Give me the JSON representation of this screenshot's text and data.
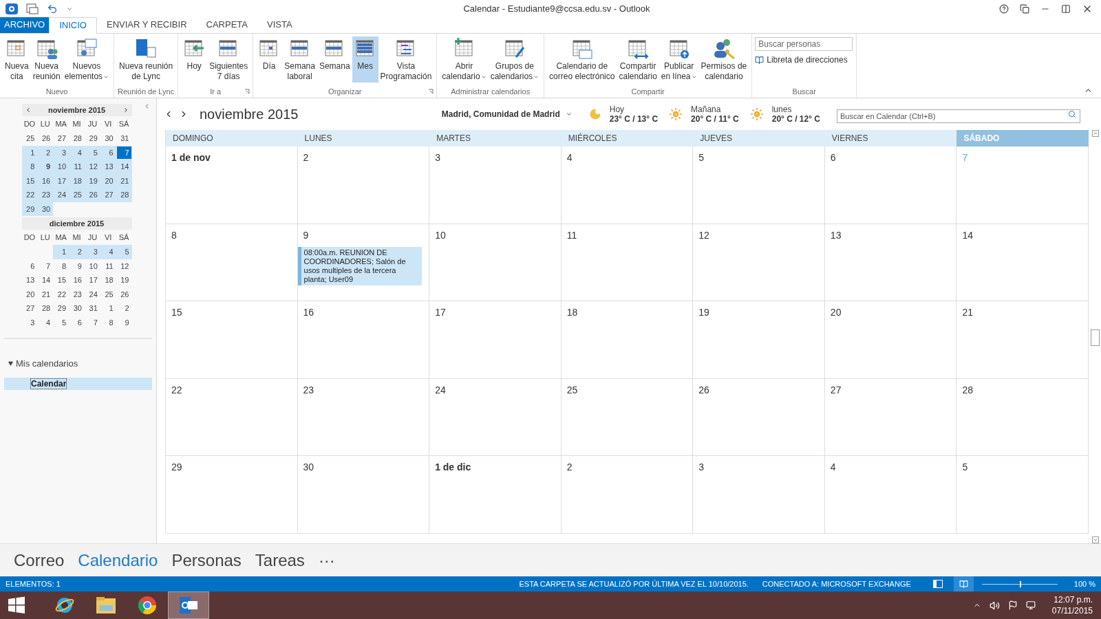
{
  "window": {
    "title": "Calendar - Estudiante9@ccsa.edu.sv - Outlook"
  },
  "ribbon_tabs": [
    {
      "label": "ARCHIVO",
      "kind": "file",
      "selected": false
    },
    {
      "label": "INICIO",
      "kind": "tab",
      "selected": true
    },
    {
      "label": "ENVIAR Y RECIBIR",
      "kind": "tab",
      "selected": false
    },
    {
      "label": "CARPETA",
      "kind": "tab",
      "selected": false
    },
    {
      "label": "VISTA",
      "kind": "tab",
      "selected": false
    }
  ],
  "ribbon_groups": [
    {
      "label": "Nuevo",
      "launcher": false,
      "buttons": [
        {
          "lines": [
            "Nueva",
            "cita"
          ],
          "kind": "plain",
          "dropdown": false,
          "selected": false
        },
        {
          "lines": [
            "Nueva",
            "reunión"
          ],
          "kind": "people",
          "dropdown": false,
          "selected": false
        },
        {
          "lines": [
            "Nuevos",
            "elementos"
          ],
          "kind": "mail",
          "dropdown": true,
          "selected": false
        }
      ]
    },
    {
      "label": "Reunión de Lync",
      "launcher": false,
      "buttons": [
        {
          "lines": [
            "Nueva reunión",
            "de Lync"
          ],
          "kind": "lync",
          "dropdown": false,
          "selected": false
        }
      ]
    },
    {
      "label": "Ir a",
      "launcher": true,
      "buttons": [
        {
          "lines": [
            "Hoy"
          ],
          "kind": "arrow",
          "dropdown": false,
          "selected": false
        },
        {
          "lines": [
            "Siguientes",
            "7 días"
          ],
          "kind": "row",
          "dropdown": false,
          "selected": false
        }
      ]
    },
    {
      "label": "Organizar",
      "launcher": true,
      "buttons": [
        {
          "lines": [
            "Día"
          ],
          "kind": "day",
          "dropdown": false,
          "selected": false
        },
        {
          "lines": [
            "Semana",
            "laboral"
          ],
          "kind": "row",
          "dropdown": false,
          "selected": false
        },
        {
          "lines": [
            "Semana"
          ],
          "kind": "row",
          "dropdown": false,
          "selected": false
        },
        {
          "lines": [
            "Mes"
          ],
          "kind": "month",
          "dropdown": false,
          "selected": true
        },
        {
          "lines": [
            "Vista",
            "Programación"
          ],
          "kind": "schedule",
          "dropdown": false,
          "selected": false
        }
      ]
    },
    {
      "label": "Administrar calendarios",
      "launcher": false,
      "buttons": [
        {
          "lines": [
            "Abrir",
            "calendario"
          ],
          "kind": "plus",
          "dropdown": true,
          "selected": false
        },
        {
          "lines": [
            "Grupos de",
            "calendarios"
          ],
          "kind": "pencil",
          "dropdown": true,
          "selected": false
        }
      ]
    },
    {
      "label": "Compartir",
      "launcher": false,
      "buttons": [
        {
          "lines": [
            "Calendario de",
            "correo electrónico"
          ],
          "kind": "envelope",
          "dropdown": false,
          "selected": false
        },
        {
          "lines": [
            "Compartir",
            "calendario"
          ],
          "kind": "share",
          "dropdown": false,
          "selected": false
        },
        {
          "lines": [
            "Publicar",
            "en línea"
          ],
          "kind": "upload",
          "dropdown": true,
          "selected": false
        },
        {
          "lines": [
            "Permisos de",
            "calendario"
          ],
          "kind": "key",
          "dropdown": false,
          "selected": false
        }
      ]
    }
  ],
  "search_group": {
    "label": "Buscar",
    "field": {
      "placeholder": "Buscar personas"
    },
    "link": "Libreta de direcciones"
  },
  "mini_calendars": [
    {
      "title": "noviembre 2015",
      "arrows": true,
      "weekdays": [
        "DO",
        "LU",
        "MA",
        "MI",
        "JU",
        "VI",
        "SÁ"
      ],
      "weeks": [
        [
          {
            "text": "25",
            "highlighted": false,
            "selected": false,
            "bold": false
          },
          {
            "text": "26",
            "highlighted": false,
            "selected": false,
            "bold": false
          },
          {
            "text": "27",
            "highlighted": false,
            "selected": false,
            "bold": false
          },
          {
            "text": "28",
            "highlighted": false,
            "selected": false,
            "bold": false
          },
          {
            "text": "29",
            "highlighted": false,
            "selected": false,
            "bold": false
          },
          {
            "text": "30",
            "highlighted": false,
            "selected": false,
            "bold": false
          },
          {
            "text": "31",
            "highlighted": false,
            "selected": false,
            "bold": false
          }
        ],
        [
          {
            "text": "1",
            "highlighted": true,
            "selected": false,
            "bold": false
          },
          {
            "text": "2",
            "highlighted": true,
            "selected": false,
            "bold": false
          },
          {
            "text": "3",
            "highlighted": true,
            "selected": false,
            "bold": false
          },
          {
            "text": "4",
            "highlighted": true,
            "selected": false,
            "bold": false
          },
          {
            "text": "5",
            "highlighted": true,
            "selected": false,
            "bold": false
          },
          {
            "text": "6",
            "highlighted": true,
            "selected": false,
            "bold": false
          },
          {
            "text": "7",
            "highlighted": true,
            "selected": true,
            "bold": false
          }
        ],
        [
          {
            "text": "8",
            "highlighted": true,
            "selected": false,
            "bold": false
          },
          {
            "text": "9",
            "highlighted": true,
            "selected": false,
            "bold": true
          },
          {
            "text": "10",
            "highlighted": true,
            "selected": false,
            "bold": false
          },
          {
            "text": "11",
            "highlighted": true,
            "selected": false,
            "bold": false
          },
          {
            "text": "12",
            "highlighted": true,
            "selected": false,
            "bold": false
          },
          {
            "text": "13",
            "highlighted": true,
            "selected": false,
            "bold": false
          },
          {
            "text": "14",
            "highlighted": true,
            "selected": false,
            "bold": false
          }
        ],
        [
          {
            "text": "15",
            "highlighted": true,
            "selected": false,
            "bold": false
          },
          {
            "text": "16",
            "highlighted": true,
            "selected": false,
            "bold": false
          },
          {
            "text": "17",
            "highlighted": true,
            "selected": false,
            "bold": false
          },
          {
            "text": "18",
            "highlighted": true,
            "selected": false,
            "bold": false
          },
          {
            "text": "19",
            "highlighted": true,
            "selected": false,
            "bold": false
          },
          {
            "text": "20",
            "highlighted": true,
            "selected": false,
            "bold": false
          },
          {
            "text": "21",
            "highlighted": true,
            "selected": false,
            "bold": false
          }
        ],
        [
          {
            "text": "22",
            "highlighted": true,
            "selected": false,
            "bold": false
          },
          {
            "text": "23",
            "highlighted": true,
            "selected": false,
            "bold": false
          },
          {
            "text": "24",
            "highlighted": true,
            "selected": false,
            "bold": false
          },
          {
            "text": "25",
            "highlighted": true,
            "selected": false,
            "bold": false
          },
          {
            "text": "26",
            "highlighted": true,
            "selected": false,
            "bold": false
          },
          {
            "text": "27",
            "highlighted": true,
            "selected": false,
            "bold": false
          },
          {
            "text": "28",
            "highlighted": true,
            "selected": false,
            "bold": false
          }
        ],
        [
          {
            "text": "29",
            "highlighted": true,
            "selected": false,
            "bold": false
          },
          {
            "text": "30",
            "highlighted": true,
            "selected": false,
            "bold": false
          }
        ]
      ]
    },
    {
      "title": "diciembre 2015",
      "arrows": false,
      "partial_first_week": true,
      "weekdays": [
        "DO",
        "LU",
        "MA",
        "MI",
        "JU",
        "VI",
        "SÁ"
      ],
      "weeks": [
        [
          {
            "text": "1",
            "highlighted": true,
            "selected": false,
            "bold": false
          },
          {
            "text": "2",
            "highlighted": true,
            "selected": false,
            "bold": false
          },
          {
            "text": "3",
            "highlighted": true,
            "selected": false,
            "bold": false
          },
          {
            "text": "4",
            "highlighted": true,
            "selected": false,
            "bold": false
          },
          {
            "text": "5",
            "highlighted": true,
            "selected": false,
            "bold": false
          }
        ],
        [
          {
            "text": "6",
            "highlighted": false,
            "selected": false,
            "bold": false
          },
          {
            "text": "7",
            "highlighted": false,
            "selected": false,
            "bold": false
          },
          {
            "text": "8",
            "highlighted": false,
            "selected": false,
            "bold": false
          },
          {
            "text": "9",
            "highlighted": false,
            "selected": false,
            "bold": false
          },
          {
            "text": "10",
            "highlighted": false,
            "selected": false,
            "bold": false
          },
          {
            "text": "11",
            "highlighted": false,
            "selected": false,
            "bold": false
          },
          {
            "text": "12",
            "highlighted": false,
            "selected": false,
            "bold": false
          }
        ],
        [
          {
            "text": "13",
            "highlighted": false,
            "selected": false,
            "bold": false
          },
          {
            "text": "14",
            "highlighted": false,
            "selected": false,
            "bold": false
          },
          {
            "text": "15",
            "highlighted": false,
            "selected": false,
            "bold": false
          },
          {
            "text": "16",
            "highlighted": false,
            "selected": false,
            "bold": false
          },
          {
            "text": "17",
            "highlighted": false,
            "selected": false,
            "bold": false
          },
          {
            "text": "18",
            "highlighted": false,
            "selected": false,
            "bold": false
          },
          {
            "text": "19",
            "highlighted": false,
            "selected": false,
            "bold": false
          }
        ],
        [
          {
            "text": "20",
            "highlighted": false,
            "selected": false,
            "bold": false
          },
          {
            "text": "21",
            "highlighted": false,
            "selected": false,
            "bold": false
          },
          {
            "text": "22",
            "highlighted": false,
            "selected": false,
            "bold": false
          },
          {
            "text": "23",
            "highlighted": false,
            "selected": false,
            "bold": false
          },
          {
            "text": "24",
            "highlighted": false,
            "selected": false,
            "bold": false
          },
          {
            "text": "25",
            "highlighted": false,
            "selected": false,
            "bold": false
          },
          {
            "text": "26",
            "highlighted": false,
            "selected": false,
            "bold": false
          }
        ],
        [
          {
            "text": "27",
            "highlighted": false,
            "selected": false,
            "bold": false
          },
          {
            "text": "28",
            "highlighted": false,
            "selected": false,
            "bold": false
          },
          {
            "text": "29",
            "highlighted": false,
            "selected": false,
            "bold": false
          },
          {
            "text": "30",
            "highlighted": false,
            "selected": false,
            "bold": false
          },
          {
            "text": "31",
            "highlighted": false,
            "selected": false,
            "bold": false
          },
          {
            "text": "1",
            "highlighted": false,
            "selected": false,
            "bold": false
          },
          {
            "text": "2",
            "highlighted": false,
            "selected": false,
            "bold": false
          }
        ],
        [
          {
            "text": "3",
            "highlighted": false,
            "selected": false,
            "bold": false
          },
          {
            "text": "4",
            "highlighted": false,
            "selected": false,
            "bold": false
          },
          {
            "text": "5",
            "highlighted": false,
            "selected": false,
            "bold": false
          },
          {
            "text": "6",
            "highlighted": false,
            "selected": false,
            "bold": false
          },
          {
            "text": "7",
            "highlighted": false,
            "selected": false,
            "bold": false
          },
          {
            "text": "8",
            "highlighted": false,
            "selected": false,
            "bold": false
          },
          {
            "text": "9",
            "highlighted": false,
            "selected": false,
            "bold": false
          }
        ]
      ]
    }
  ],
  "folders": {
    "heading": "Mis calendarios",
    "expanded": true,
    "items": [
      {
        "label": "Calendar",
        "selected": true
      }
    ]
  },
  "calendar_header": {
    "title": "noviembre 2015",
    "location": "Madrid, Comunidad de Madrid",
    "weather": [
      {
        "label": "Hoy",
        "temps": "23° C / 13° C",
        "kind": "moon"
      },
      {
        "label": "Mañana",
        "temps": "20° C / 11° C",
        "kind": "sun"
      },
      {
        "label": "lunes",
        "temps": "20° C / 12° C",
        "kind": "sun"
      }
    ],
    "search": {
      "placeholder": "Buscar en Calendar (Ctrl+B)"
    }
  },
  "day_headers": [
    {
      "label": "DOMINGO",
      "selected": false
    },
    {
      "label": "LUNES",
      "selected": false
    },
    {
      "label": "MARTES",
      "selected": false
    },
    {
      "label": "MIÉRCOLES",
      "selected": false
    },
    {
      "label": "JUEVES",
      "selected": false
    },
    {
      "label": "VIERNES",
      "selected": false
    },
    {
      "label": "SÁBADO",
      "selected": true
    }
  ],
  "weeks": [
    [
      {
        "label": "1 de nov",
        "bold": true,
        "today": false
      },
      {
        "label": "2",
        "bold": false,
        "today": false
      },
      {
        "label": "3",
        "bold": false,
        "today": false
      },
      {
        "label": "4",
        "bold": false,
        "today": false
      },
      {
        "label": "5",
        "bold": false,
        "today": false
      },
      {
        "label": "6",
        "bold": false,
        "today": false
      },
      {
        "label": "7",
        "bold": false,
        "today": true
      }
    ],
    [
      {
        "label": "8",
        "bold": false,
        "today": false
      },
      {
        "label": "9",
        "bold": false,
        "today": false,
        "events": [
          "08:00a.m. REUNION DE COORDINADORES; Salón de usos multiples de la tercera planta; User09"
        ]
      },
      {
        "label": "10",
        "bold": false,
        "today": false
      },
      {
        "label": "11",
        "bold": false,
        "today": false
      },
      {
        "label": "12",
        "bold": false,
        "today": false
      },
      {
        "label": "13",
        "bold": false,
        "today": false
      },
      {
        "label": "14",
        "bold": false,
        "today": false
      }
    ],
    [
      {
        "label": "15",
        "bold": false,
        "today": false
      },
      {
        "label": "16",
        "bold": false,
        "today": false
      },
      {
        "label": "17",
        "bold": false,
        "today": false
      },
      {
        "label": "18",
        "bold": false,
        "today": false
      },
      {
        "label": "19",
        "bold": false,
        "today": false
      },
      {
        "label": "20",
        "bold": false,
        "today": false
      },
      {
        "label": "21",
        "bold": false,
        "today": false
      }
    ],
    [
      {
        "label": "22",
        "bold": false,
        "today": false
      },
      {
        "label": "23",
        "bold": false,
        "today": false
      },
      {
        "label": "24",
        "bold": false,
        "today": false
      },
      {
        "label": "25",
        "bold": false,
        "today": false
      },
      {
        "label": "26",
        "bold": false,
        "today": false
      },
      {
        "label": "27",
        "bold": false,
        "today": false
      },
      {
        "label": "28",
        "bold": false,
        "today": false
      }
    ],
    [
      {
        "label": "29",
        "bold": false,
        "today": false
      },
      {
        "label": "30",
        "bold": false,
        "today": false
      },
      {
        "label": "1 de dic",
        "bold": true,
        "today": false
      },
      {
        "label": "2",
        "bold": false,
        "today": false
      },
      {
        "label": "3",
        "bold": false,
        "today": false
      },
      {
        "label": "4",
        "bold": false,
        "today": false
      },
      {
        "label": "5",
        "bold": false,
        "today": false
      }
    ]
  ],
  "bottom_nav": [
    {
      "label": "Correo",
      "selected": false
    },
    {
      "label": "Calendario",
      "selected": true
    },
    {
      "label": "Personas",
      "selected": false
    },
    {
      "label": "Tareas",
      "selected": false
    },
    {
      "label": "···",
      "selected": false
    }
  ],
  "status_bar": {
    "items": "ELEMENTOS: 1",
    "updated": "ESTA CARPETA SE ACTUALIZÓ POR ÚLTIMA VEZ EL 10/10/2015.",
    "connection": "CONECTADO A: MICROSOFT EXCHANGE",
    "zoom": {
      "level": 0.5,
      "reading": "100 %"
    }
  },
  "taskbar": {
    "apps": [
      {
        "kind": "ie",
        "selected": false
      },
      {
        "kind": "explorer",
        "selected": false
      },
      {
        "kind": "chrome",
        "selected": false
      },
      {
        "kind": "outlook",
        "selected": true
      }
    ],
    "time": "12:07 p.m.",
    "date": "07/11/2015"
  }
}
